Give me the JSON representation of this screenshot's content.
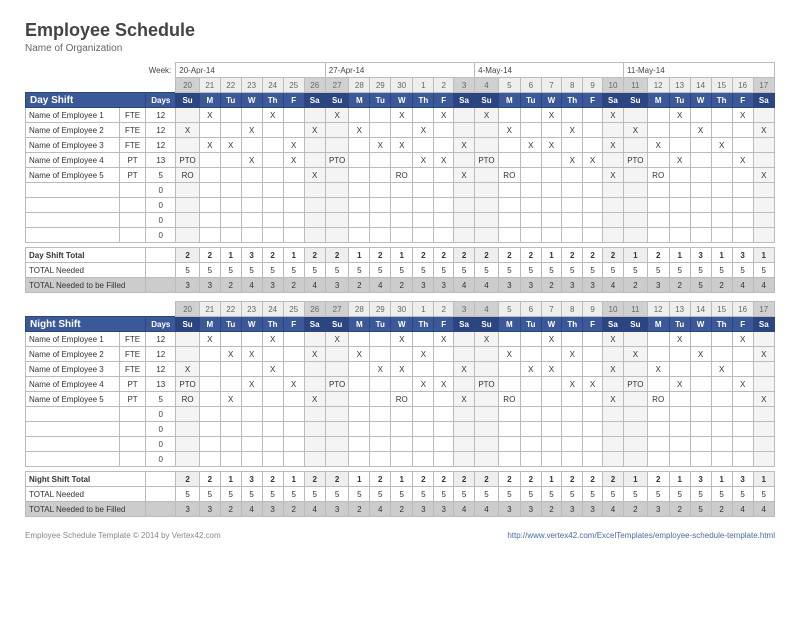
{
  "title": "Employee Schedule",
  "subtitle": "Name of Organization",
  "weekLabel": "Week:",
  "weekDates": [
    "20-Apr-14",
    "27-Apr-14",
    "4-May-14",
    "11-May-14"
  ],
  "dayNums": [
    "20",
    "21",
    "22",
    "23",
    "24",
    "25",
    "26",
    "27",
    "28",
    "29",
    "30",
    "1",
    "2",
    "3",
    "4",
    "5",
    "6",
    "7",
    "8",
    "9",
    "10",
    "11",
    "12",
    "13",
    "14",
    "15",
    "16",
    "17"
  ],
  "dayNames": [
    "Su",
    "M",
    "Tu",
    "W",
    "Th",
    "F",
    "Sa",
    "Su",
    "M",
    "Tu",
    "W",
    "Th",
    "F",
    "Sa",
    "Su",
    "M",
    "Tu",
    "W",
    "Th",
    "F",
    "Sa",
    "Su",
    "M",
    "Tu",
    "W",
    "Th",
    "F",
    "Sa"
  ],
  "shaded": [
    0,
    6,
    7,
    13,
    14,
    20,
    21,
    27
  ],
  "daysHdr": "Days",
  "shifts": [
    {
      "name": "Day Shift",
      "rows": [
        {
          "n": "Name of Employee 1",
          "t": "FTE",
          "d": "12",
          "c": [
            "",
            "X",
            "",
            "",
            "X",
            "",
            "",
            "X",
            "",
            "",
            "X",
            "",
            "X",
            "",
            "X",
            "",
            "",
            "X",
            "",
            "",
            "X",
            "",
            "",
            "X",
            "",
            "",
            "X",
            ""
          ]
        },
        {
          "n": "Name of Employee 2",
          "t": "FTE",
          "d": "12",
          "c": [
            "X",
            "",
            "",
            "X",
            "",
            "",
            "X",
            "",
            "X",
            "",
            "",
            "X",
            "",
            "",
            "",
            "X",
            "",
            "",
            "X",
            "",
            "",
            "X",
            "",
            "",
            "X",
            "",
            "",
            "X"
          ]
        },
        {
          "n": "Name of Employee 3",
          "t": "FTE",
          "d": "12",
          "c": [
            "",
            "X",
            "X",
            "",
            "",
            "X",
            "",
            "",
            "",
            "X",
            "X",
            "",
            "",
            "X",
            "",
            "",
            "X",
            "X",
            "",
            "",
            "X",
            "",
            "X",
            "",
            "",
            "X",
            "",
            ""
          ]
        },
        {
          "n": "Name of Employee 4",
          "t": "PT",
          "d": "13",
          "c": [
            "PTO",
            "",
            "",
            "X",
            "",
            "X",
            "",
            "PTO",
            "",
            "",
            "",
            "X",
            "X",
            "",
            "PTO",
            "",
            "",
            "",
            "X",
            "X",
            "",
            "PTO",
            "",
            "X",
            "",
            "",
            "X",
            ""
          ]
        },
        {
          "n": "Name of Employee 5",
          "t": "PT",
          "d": "5",
          "c": [
            "RO",
            "",
            "",
            "",
            "",
            "",
            "X",
            "",
            "",
            "",
            "RO",
            "",
            "",
            "X",
            "",
            "RO",
            "",
            "",
            "",
            "",
            "X",
            "",
            "RO",
            "",
            "",
            "",
            "",
            "X"
          ]
        },
        {
          "n": "",
          "t": "",
          "d": "0",
          "c": []
        },
        {
          "n": "",
          "t": "",
          "d": "0",
          "c": []
        },
        {
          "n": "",
          "t": "",
          "d": "0",
          "c": []
        },
        {
          "n": "",
          "t": "",
          "d": "0",
          "c": []
        }
      ],
      "totals": [
        {
          "lbl": "Day Shift Total",
          "v": [
            "2",
            "2",
            "1",
            "3",
            "2",
            "1",
            "2",
            "2",
            "1",
            "2",
            "1",
            "2",
            "2",
            "2",
            "2",
            "2",
            "2",
            "1",
            "2",
            "2",
            "2",
            "1",
            "2",
            "1",
            "3",
            "1",
            "3",
            "1"
          ],
          "cl": "tot1"
        },
        {
          "lbl": "TOTAL Needed",
          "v": [
            "5",
            "5",
            "5",
            "5",
            "5",
            "5",
            "5",
            "5",
            "5",
            "5",
            "5",
            "5",
            "5",
            "5",
            "5",
            "5",
            "5",
            "5",
            "5",
            "5",
            "5",
            "5",
            "5",
            "5",
            "5",
            "5",
            "5",
            "5"
          ],
          "cl": "tot2"
        },
        {
          "lbl": "TOTAL Needed to be Filled",
          "v": [
            "3",
            "3",
            "2",
            "4",
            "3",
            "2",
            "4",
            "3",
            "2",
            "4",
            "2",
            "3",
            "3",
            "4",
            "4",
            "3",
            "3",
            "2",
            "3",
            "3",
            "4",
            "2",
            "3",
            "2",
            "5",
            "2",
            "4",
            "4"
          ],
          "cl": "tot3"
        }
      ]
    },
    {
      "name": "Night Shift",
      "rows": [
        {
          "n": "Name of Employee 1",
          "t": "FTE",
          "d": "12",
          "c": [
            "",
            "X",
            "",
            "",
            "X",
            "",
            "",
            "X",
            "",
            "",
            "X",
            "",
            "X",
            "",
            "X",
            "",
            "",
            "X",
            "",
            "",
            "X",
            "",
            "",
            "X",
            "",
            "",
            "X",
            ""
          ]
        },
        {
          "n": "Name of Employee 2",
          "t": "FTE",
          "d": "12",
          "c": [
            "",
            "",
            "X",
            "X",
            "",
            "",
            "X",
            "",
            "X",
            "",
            "",
            "X",
            "",
            "",
            "",
            "X",
            "",
            "",
            "X",
            "",
            "",
            "X",
            "",
            "",
            "X",
            "",
            "",
            "X"
          ]
        },
        {
          "n": "Name of Employee 3",
          "t": "FTE",
          "d": "12",
          "c": [
            "X",
            "",
            "",
            "",
            "X",
            "",
            "",
            "",
            "",
            "X",
            "X",
            "",
            "",
            "X",
            "",
            "",
            "X",
            "X",
            "",
            "",
            "X",
            "",
            "X",
            "",
            "",
            "X",
            "",
            ""
          ]
        },
        {
          "n": "Name of Employee 4",
          "t": "PT",
          "d": "13",
          "c": [
            "PTO",
            "",
            "",
            "X",
            "",
            "X",
            "",
            "PTO",
            "",
            "",
            "",
            "X",
            "X",
            "",
            "PTO",
            "",
            "",
            "",
            "X",
            "X",
            "",
            "PTO",
            "",
            "X",
            "",
            "",
            "X",
            ""
          ]
        },
        {
          "n": "Name of Employee 5",
          "t": "PT",
          "d": "5",
          "c": [
            "RO",
            "",
            "X",
            "",
            "",
            "",
            "X",
            "",
            "",
            "",
            "RO",
            "",
            "",
            "X",
            "",
            "RO",
            "",
            "",
            "",
            "",
            "X",
            "",
            "RO",
            "",
            "",
            "",
            "",
            "X"
          ]
        },
        {
          "n": "",
          "t": "",
          "d": "0",
          "c": []
        },
        {
          "n": "",
          "t": "",
          "d": "0",
          "c": []
        },
        {
          "n": "",
          "t": "",
          "d": "0",
          "c": []
        },
        {
          "n": "",
          "t": "",
          "d": "0",
          "c": []
        }
      ],
      "totals": [
        {
          "lbl": "Night Shift Total",
          "v": [
            "2",
            "2",
            "1",
            "3",
            "2",
            "1",
            "2",
            "2",
            "1",
            "2",
            "1",
            "2",
            "2",
            "2",
            "2",
            "2",
            "2",
            "1",
            "2",
            "2",
            "2",
            "1",
            "2",
            "1",
            "3",
            "1",
            "3",
            "1"
          ],
          "cl": "tot1"
        },
        {
          "lbl": "TOTAL Needed",
          "v": [
            "5",
            "5",
            "5",
            "5",
            "5",
            "5",
            "5",
            "5",
            "5",
            "5",
            "5",
            "5",
            "5",
            "5",
            "5",
            "5",
            "5",
            "5",
            "5",
            "5",
            "5",
            "5",
            "5",
            "5",
            "5",
            "5",
            "5",
            "5"
          ],
          "cl": "tot2"
        },
        {
          "lbl": "TOTAL Needed to be Filled",
          "v": [
            "3",
            "3",
            "2",
            "4",
            "3",
            "2",
            "4",
            "3",
            "2",
            "4",
            "2",
            "3",
            "3",
            "4",
            "4",
            "3",
            "3",
            "2",
            "3",
            "3",
            "4",
            "2",
            "3",
            "2",
            "5",
            "2",
            "4",
            "4"
          ],
          "cl": "tot3"
        }
      ]
    }
  ],
  "footer": {
    "left": "Employee Schedule Template © 2014 by Vertex42.com",
    "right": "http://www.vertex42.com/ExcelTemplates/employee-schedule-template.html"
  }
}
